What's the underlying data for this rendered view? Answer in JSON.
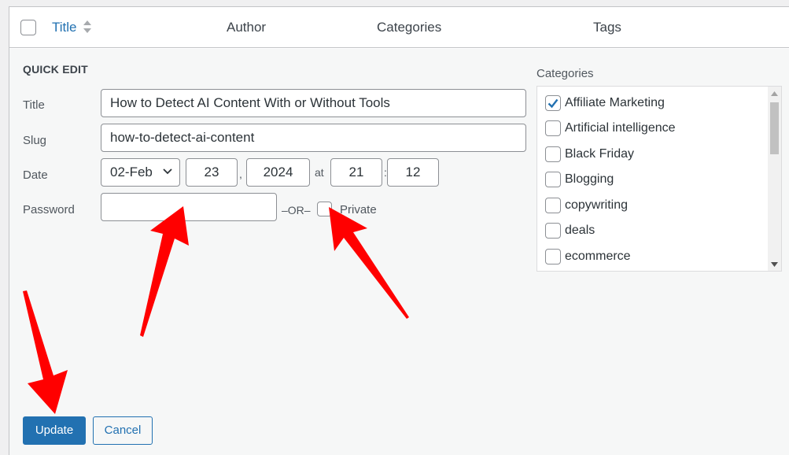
{
  "table_header": {
    "title": "Title",
    "author": "Author",
    "categories": "Categories",
    "tags": "Tags"
  },
  "quick_edit": {
    "heading": "QUICK EDIT",
    "title_label": "Title",
    "title_value": "How to Detect AI Content With or Without Tools",
    "slug_label": "Slug",
    "slug_value": "how-to-detect-ai-content",
    "date_label": "Date",
    "date_month": "02-Feb",
    "date_day": "23",
    "date_comma": ",",
    "date_year": "2024",
    "date_at": "at",
    "date_hour": "21",
    "date_colon": ":",
    "date_minute": "12",
    "password_label": "Password",
    "password_value": "",
    "or_text": "–OR–",
    "private_label": "Private"
  },
  "categories": {
    "heading": "Categories",
    "items": [
      {
        "label": "Affiliate Marketing",
        "checked": true
      },
      {
        "label": "Artificial intelligence",
        "checked": false
      },
      {
        "label": "Black Friday",
        "checked": false
      },
      {
        "label": "Blogging",
        "checked": false
      },
      {
        "label": "copywriting",
        "checked": false
      },
      {
        "label": "deals",
        "checked": false
      },
      {
        "label": "ecommerce",
        "checked": false
      }
    ]
  },
  "buttons": {
    "update": "Update",
    "cancel": "Cancel"
  },
  "colors": {
    "primary": "#2271b1",
    "annotation_arrow": "#ff0000"
  },
  "icons": [
    "sort-icon",
    "chevron-down-icon",
    "checkmark-icon",
    "scroll-up-icon",
    "scroll-down-icon",
    "red-arrow-annotation"
  ]
}
